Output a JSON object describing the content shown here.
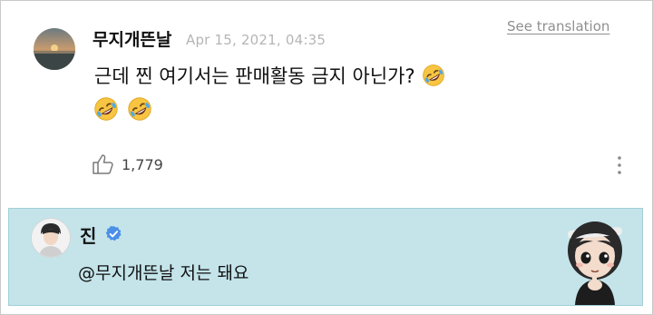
{
  "comment": {
    "author": "무지개뜬날",
    "timestamp": "Apr 15, 2021, 04:35",
    "see_translation": "See translation",
    "text": "근데 찐 여기서는 판매활동 금지 아닌가?",
    "emoji": "rolling-on-the-floor-laughing-emoji",
    "like_count": "1,779"
  },
  "reply": {
    "author": "진",
    "mention": "@무지개뜬날",
    "text": "저는 돼요",
    "background_color": "#c4e4ea"
  },
  "icons": {
    "like": "thumbs-up-icon",
    "more": "more-vertical-icon",
    "verified": "verified-badge-icon"
  }
}
